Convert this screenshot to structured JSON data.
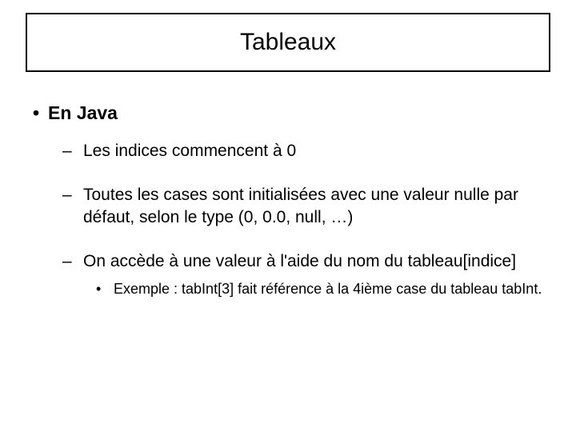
{
  "title": "Tableaux",
  "heading": "En Java",
  "sub1": "Les indices commencent à 0",
  "sub2": "Toutes les cases sont initialisées avec une valeur nulle par défaut, selon le type (0, 0.0, null, …)",
  "sub3": "On accède à une valeur à l'aide du nom du tableau[indice]",
  "sub3a": "Exemple : tabInt[3] fait référence à la 4ième case du tableau tabInt."
}
